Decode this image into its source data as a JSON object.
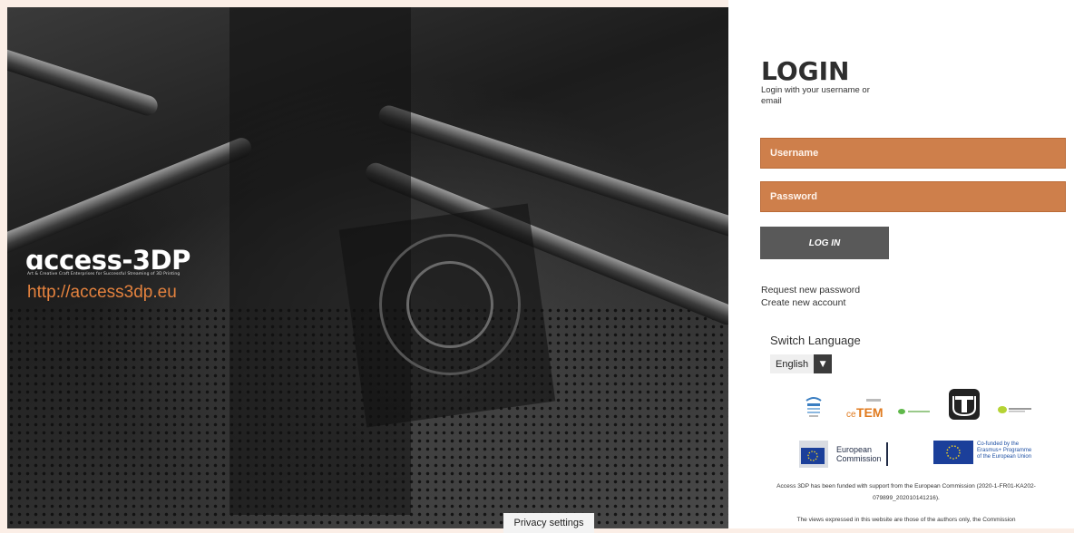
{
  "hero": {
    "brand": "ɑccess-3DP",
    "tagline": "Art & Creative Craft Enterprises for Successful Streaming of 3D Printing",
    "url": "http://access3dp.eu",
    "privacy_label": "Privacy settings"
  },
  "login": {
    "title": "LOGIN",
    "subtitle": "Login with your username or email",
    "username_placeholder": "Username",
    "password_placeholder": "Password",
    "button_label": "LOG IN",
    "request_password": "Request new password",
    "create_account": "Create new account"
  },
  "language": {
    "label": "Switch Language",
    "selected": "English"
  },
  "partners": {
    "cetem_label": "ceTEM"
  },
  "eu": {
    "commission_line1": "European",
    "commission_line2": "Commission",
    "cofunded_line1": "Co-funded by the",
    "cofunded_line2": "Erasmus+ Programme",
    "cofunded_line3": "of the European Union"
  },
  "footer": {
    "funding": "Access 3DP has been funded with support from the European Commission (2020-1-FR01-KA202-079899_202010141216).",
    "views": "The views expressed in this website are those of the authors only, the Commission"
  },
  "colors": {
    "accent": "#ce7f4b",
    "button": "#595959",
    "url": "#e4823e",
    "background": "#fbeee6"
  }
}
